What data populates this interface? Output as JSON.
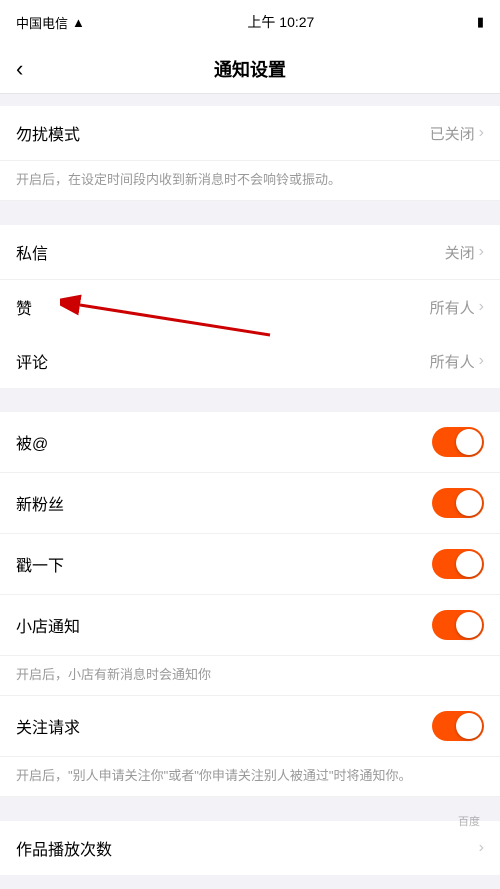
{
  "statusBar": {
    "carrier": "中国电信",
    "wifi": "WiFi",
    "time": "上午 10:27",
    "battery": "100%"
  },
  "navBar": {
    "backLabel": "‹",
    "title": "通知设置"
  },
  "sections": [
    {
      "id": "dnd",
      "rows": [
        {
          "id": "dnd-mode",
          "label": "勿扰模式",
          "rightText": "已关闭",
          "type": "link"
        }
      ],
      "description": "开启后，在设定时间段内收到新消息时不会响铃或振动。"
    },
    {
      "id": "message",
      "rows": [
        {
          "id": "private-message",
          "label": "私信",
          "rightText": "关闭",
          "type": "link"
        },
        {
          "id": "like",
          "label": "赞",
          "rightText": "所有人",
          "type": "link",
          "annotated": true
        },
        {
          "id": "comment",
          "label": "评论",
          "rightText": "所有人",
          "type": "link"
        }
      ]
    },
    {
      "id": "toggles",
      "rows": [
        {
          "id": "mention",
          "label": "被@",
          "type": "toggle",
          "enabled": true
        },
        {
          "id": "new-fans",
          "label": "新粉丝",
          "type": "toggle",
          "enabled": true
        },
        {
          "id": "poke",
          "label": "戳一下",
          "type": "toggle",
          "enabled": true
        },
        {
          "id": "shop-notify",
          "label": "小店通知",
          "type": "toggle",
          "enabled": true,
          "description": "开启后，小店有新消息时会通知你"
        },
        {
          "id": "follow-request",
          "label": "关注请求",
          "type": "toggle",
          "enabled": true,
          "description": "开启后，\"别人申请关注你\"或者\"你申请关注别人被通过\"时将通知你。"
        }
      ]
    },
    {
      "id": "play-count",
      "rows": [
        {
          "id": "play-count-row",
          "label": "作品播放次数",
          "type": "link"
        }
      ]
    }
  ],
  "annotation": {
    "arrow_alt": "red arrow pointing to 赞 row"
  }
}
